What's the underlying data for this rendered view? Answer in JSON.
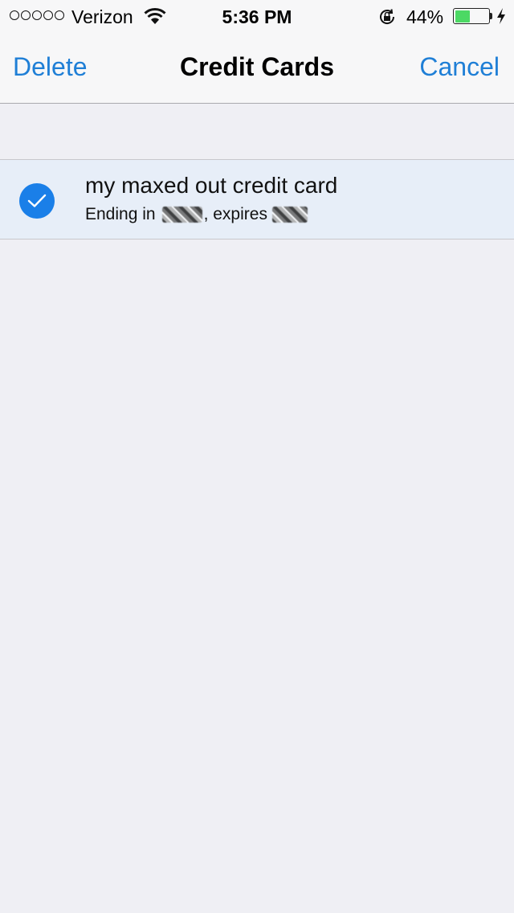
{
  "status_bar": {
    "signal_dots": 5,
    "carrier": "Verizon",
    "wifi_icon": "wifi-icon",
    "time": "5:36 PM",
    "rotation_lock_icon": "rotation-lock-icon",
    "battery_percent_label": "44%",
    "battery_level": 0.44,
    "battery_color": "#4cd964",
    "charging_icon": "charging-bolt-icon"
  },
  "nav": {
    "left_label": "Delete",
    "title": "Credit Cards",
    "right_label": "Cancel",
    "accent_color": "#1f7fd6"
  },
  "cards": [
    {
      "name": "my maxed out credit card",
      "ending_prefix": "Ending in",
      "last_digits": "[redacted]",
      "expires_label": ", expires",
      "expiry": "[redacted]",
      "selected": true
    }
  ]
}
